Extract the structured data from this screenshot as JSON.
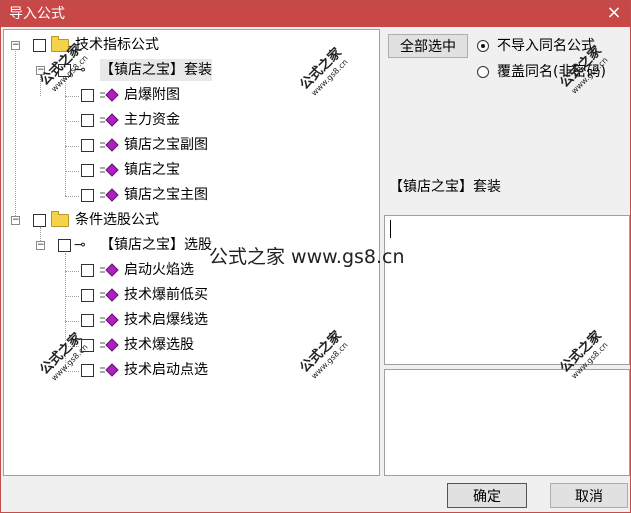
{
  "window": {
    "title": "导入公式",
    "close_glyph": "×"
  },
  "tree": {
    "groups": [
      {
        "label": "技术指标公式",
        "sub": {
          "label": "【镇店之宝】套装",
          "items": [
            "启爆附图",
            "主力资金",
            "镇店之宝副图",
            "镇店之宝",
            "镇店之宝主图"
          ]
        }
      },
      {
        "label": "条件选股公式",
        "sub": {
          "label": "【镇店之宝】选股",
          "items": [
            "启动火焰选",
            "技术爆前低买",
            "技术启爆线选",
            "技术爆选股",
            "技术启动点选"
          ]
        }
      }
    ],
    "expanded_glyph": "−"
  },
  "right_panel": {
    "select_all_label": "全部选中",
    "radio_options": [
      {
        "label": "不导入同名公式",
        "checked": true
      },
      {
        "label": "覆盖同名(非密码)",
        "checked": false
      }
    ],
    "selected_name": "【镇店之宝】套装"
  },
  "footer": {
    "ok_label": "确定",
    "cancel_label": "取消"
  },
  "watermark": {
    "text": "公式之家",
    "url": "www.gs8.cn",
    "center_text": "公式之家 www.gs8.cn"
  },
  "colors": {
    "titlebar": "#c84848",
    "folder": "#f4d34a",
    "formula_diamond": "#b020c0"
  }
}
